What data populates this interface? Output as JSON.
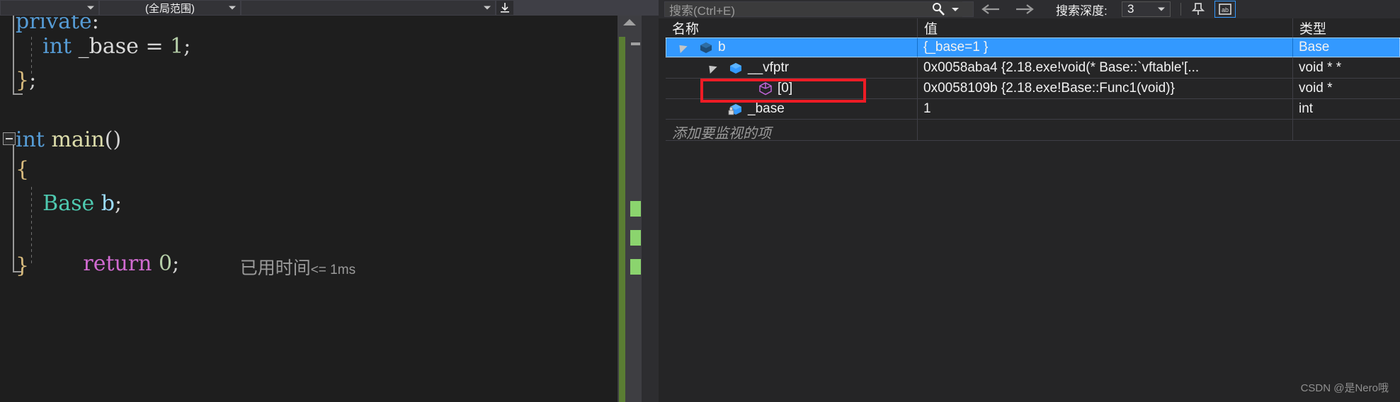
{
  "editor": {
    "nav": {
      "scope_left": "",
      "scope_middle": "(全局范围)",
      "scope_right": "",
      "updown_icon": "navigate-down-icon"
    },
    "code_lines": [
      {
        "tokens": [
          {
            "t": "private",
            "c": "kw"
          },
          {
            "t": ":",
            "c": "punct"
          }
        ]
      },
      {
        "tokens": [
          {
            "t": "    int",
            "c": "kw"
          },
          {
            "t": " _base",
            "c": "ident"
          },
          {
            "t": " = ",
            "c": "punct"
          },
          {
            "t": "1",
            "c": "num"
          },
          {
            "t": ";",
            "c": "punct"
          }
        ]
      },
      {
        "tokens": [
          {
            "t": "}",
            "c": "brace"
          },
          {
            "t": ";",
            "c": "punct"
          }
        ]
      },
      {
        "tokens": []
      },
      {
        "tokens": [
          {
            "t": "int",
            "c": "kw"
          },
          {
            "t": " ",
            "c": "punct"
          },
          {
            "t": "main",
            "c": "fn"
          },
          {
            "t": "()",
            "c": "punct"
          }
        ]
      },
      {
        "tokens": [
          {
            "t": "{",
            "c": "brace"
          }
        ]
      },
      {
        "tokens": [
          {
            "t": "    Base",
            "c": "typ"
          },
          {
            "t": " b",
            "c": "var"
          },
          {
            "t": ";",
            "c": "punct"
          }
        ]
      },
      {
        "tokens": [
          {
            "t": "    return",
            "c": "kwret"
          },
          {
            "t": " ",
            "c": "punct"
          },
          {
            "t": "0",
            "c": "num"
          },
          {
            "t": ";",
            "c": "punct"
          }
        ]
      },
      {
        "tokens": [
          {
            "t": "}",
            "c": "brace"
          }
        ]
      }
    ],
    "elapsed_time": "已用时间",
    "elapsed_value": "<= 1ms",
    "scrollbar": {
      "up_arrow_icon": "scroll-up-arrow-icon",
      "thumb_color": "#5a7d33",
      "change_marks": 3,
      "mark_color": "#8bd46e"
    }
  },
  "watch": {
    "toolbar": {
      "search_placeholder": "搜索(Ctrl+E)",
      "search_icon": "search-magnifier-icon",
      "search_dropdown_icon": "chevron-down-icon",
      "back_icon": "arrow-left-icon",
      "forward_icon": "arrow-right-icon",
      "depth_label": "搜索深度:",
      "depth_value": "3",
      "depth_caret_icon": "chevron-down-icon",
      "pin_icon": "pin-icon",
      "hex_icon": "hexadecimal-display-icon",
      "hex_active_color": "#3399ff"
    },
    "columns": [
      "名称",
      "值",
      "类型"
    ],
    "rows": [
      {
        "indent": 0,
        "expander": "expanded",
        "icon": "object-cube-icon",
        "name": "b",
        "value": "{_base=1 }",
        "type": "Base",
        "selected": true
      },
      {
        "indent": 1,
        "expander": "expanded",
        "icon": "pointer-cube-icon",
        "name": "__vfptr",
        "value": "0x0058aba4 {2.18.exe!void(* Base::`vftable'[...",
        "type": "void * *",
        "selected": false,
        "highlight": true
      },
      {
        "indent": 2,
        "expander": "none",
        "icon": "function-pointer-icon",
        "name": "[0]",
        "value": "0x0058109b {2.18.exe!Base::Func1(void)}",
        "type": "void *",
        "selected": false
      },
      {
        "indent": 1,
        "expander": "none",
        "icon": "private-field-icon",
        "name": "_base",
        "value": "1",
        "type": "int",
        "selected": false
      }
    ],
    "add_watch_placeholder": "添加要监视的项",
    "selection_color": "#3399ff",
    "highlight_color": "#ee1c25"
  },
  "watermark": "CSDN @是Nero哦"
}
